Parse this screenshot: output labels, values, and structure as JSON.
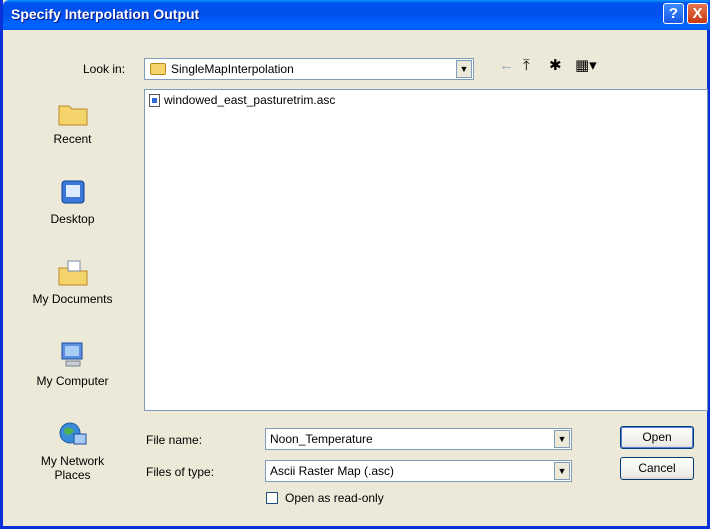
{
  "window": {
    "title": "Specify Interpolation Output"
  },
  "titlebar": {
    "help_label": "?",
    "close_label": "X"
  },
  "lookin": {
    "label": "Look in:",
    "value": "SingleMapInterpolation"
  },
  "toolbar": {
    "back_icon": "←",
    "up_icon": "⤒",
    "newfolder_icon": "✱",
    "views_icon": "▦▾"
  },
  "places": [
    {
      "label": "Recent"
    },
    {
      "label": "Desktop"
    },
    {
      "label": "My Documents"
    },
    {
      "label": "My Computer"
    },
    {
      "label": "My Network Places"
    }
  ],
  "files": [
    {
      "name": "windowed_east_pasturetrim.asc"
    }
  ],
  "filename": {
    "label": "File name:",
    "value": "Noon_Temperature"
  },
  "filetype": {
    "label": "Files of type:",
    "value": "Ascii Raster Map (.asc)"
  },
  "readonly": {
    "label": "Open as read-only",
    "checked": false
  },
  "buttons": {
    "open": "Open",
    "cancel": "Cancel"
  },
  "colors": {
    "titlebar": "#0054E3",
    "face": "#ECE9D8",
    "border": "#7F9DB9"
  }
}
